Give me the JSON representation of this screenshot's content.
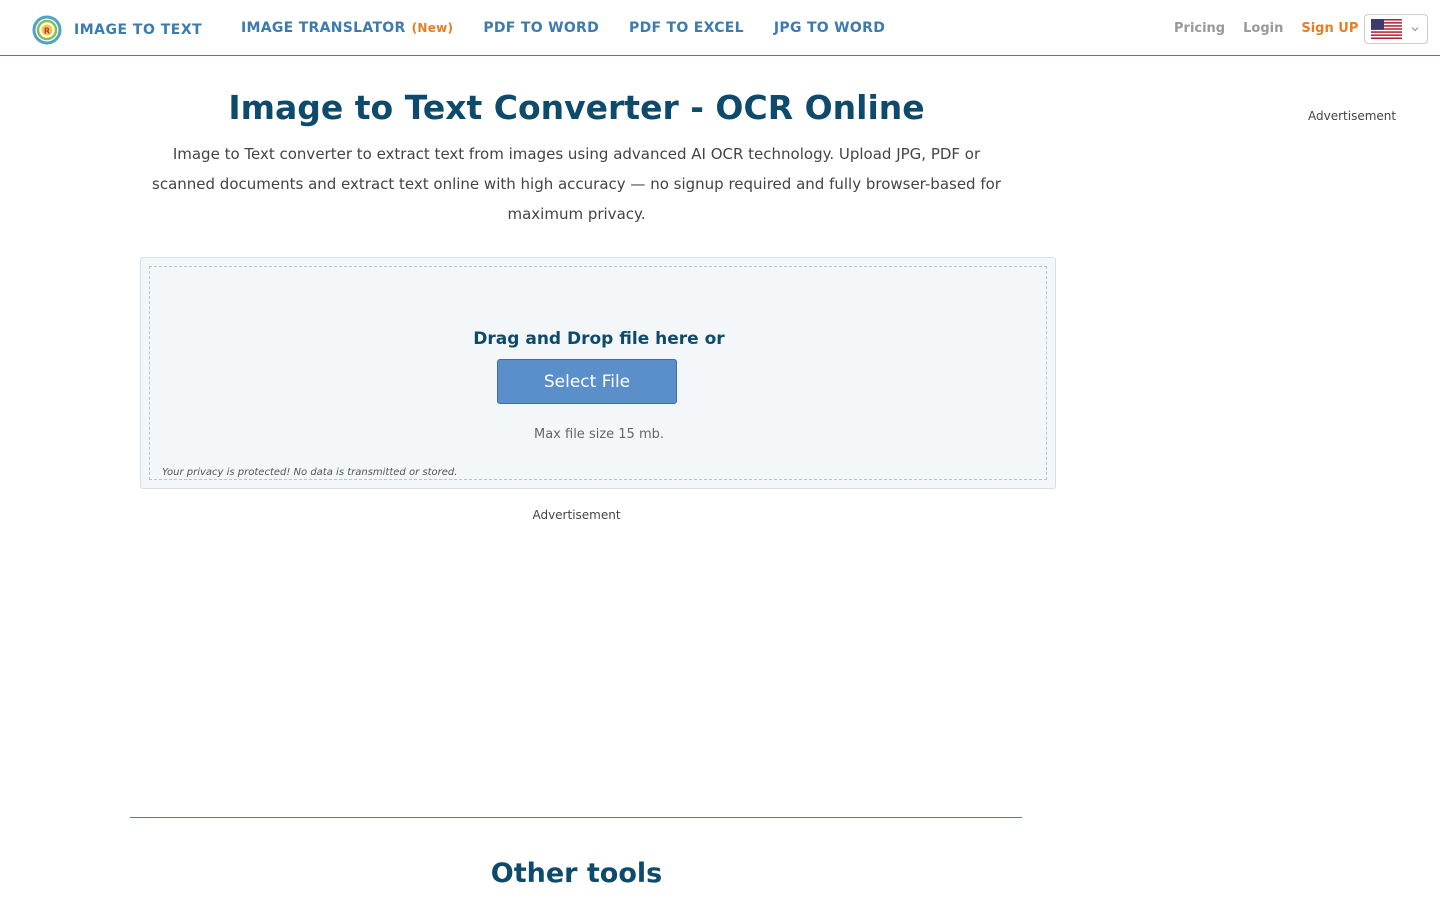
{
  "header": {
    "logo_text": "IMAGE TO TEXT",
    "logo_icon": "ocr-logo-icon",
    "nav": [
      {
        "label": "IMAGE TRANSLATOR",
        "tag": "(New)"
      },
      {
        "label": "PDF TO WORD"
      },
      {
        "label": "PDF TO EXCEL"
      },
      {
        "label": "JPG TO WORD"
      }
    ],
    "pricing": "Pricing",
    "login": "Login",
    "signup": "Sign UP",
    "language_icon": "us-flag-icon"
  },
  "main": {
    "title": "Image to Text Converter - OCR Online",
    "subtitle": "Image to Text converter to extract text from images using advanced AI OCR technology. Upload JPG, PDF or scanned documents and extract text online with high accuracy — no signup required and fully browser-based for maximum privacy.",
    "advertisement_right": "Advertisement",
    "drop_text": "Drag and Drop file here or",
    "select_button": "Select File",
    "max_size": "Max file size 15 mb.",
    "privacy": "Your privacy is protected! No data is transmitted or stored.",
    "advertisement_center": "Advertisement",
    "other_tools": "Other tools"
  },
  "colors": {
    "brand_dark": "#0d4a6b",
    "link_blue": "#3b7bb0",
    "accent_orange": "#e67e22",
    "button_blue": "#5b8fc9"
  }
}
